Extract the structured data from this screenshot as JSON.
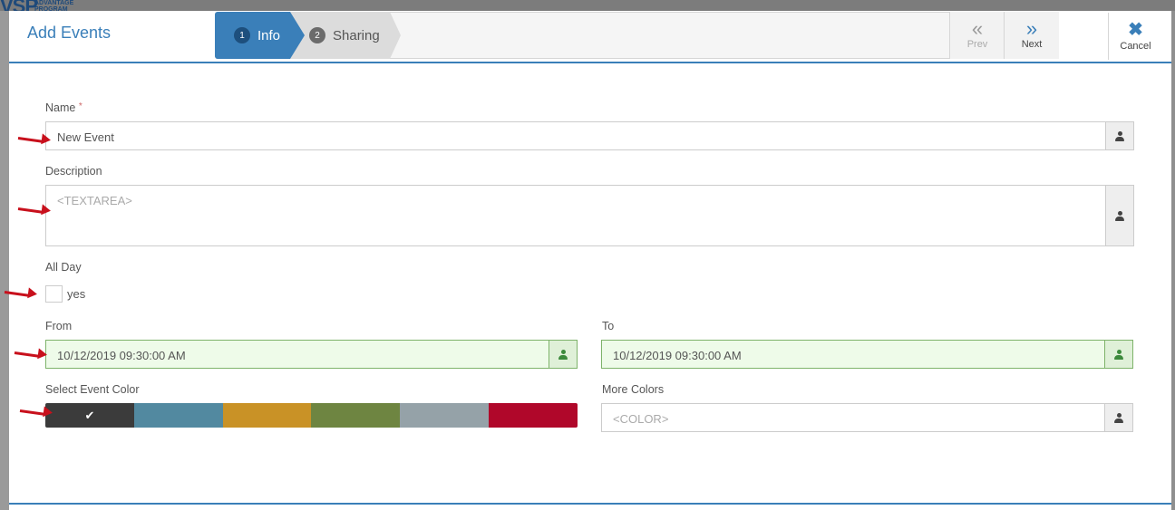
{
  "background": {
    "logo_main": "VSP",
    "logo_sub": "ADVANTAGE PROGRAM"
  },
  "header": {
    "title": "Add Events",
    "steps": [
      {
        "number": "1",
        "label": "Info",
        "active": true
      },
      {
        "number": "2",
        "label": "Sharing",
        "active": false
      }
    ],
    "prev_label": "Prev",
    "next_label": "Next",
    "cancel_label": "Cancel"
  },
  "form": {
    "name_label": "Name",
    "name_required": "*",
    "name_value": "New Event",
    "description_label": "Description",
    "description_placeholder": "<TEXTAREA>",
    "allday_label": "All Day",
    "allday_option": "yes",
    "allday_checked": false,
    "from_label": "From",
    "from_value": "10/12/2019 09:30:00 AM",
    "to_label": "To",
    "to_value": "10/12/2019 09:30:00 AM",
    "color_label": "Select Event Color",
    "colors": [
      "#3b3b3b",
      "#5289a0",
      "#c99226",
      "#6e8541",
      "#95a2a8",
      "#b0072a"
    ],
    "selected_color_index": 0,
    "more_colors_label": "More Colors",
    "more_colors_placeholder": "<COLOR>"
  },
  "theme": {
    "accent": "#3a7fb9",
    "annotation_arrow": "#c8101c"
  }
}
